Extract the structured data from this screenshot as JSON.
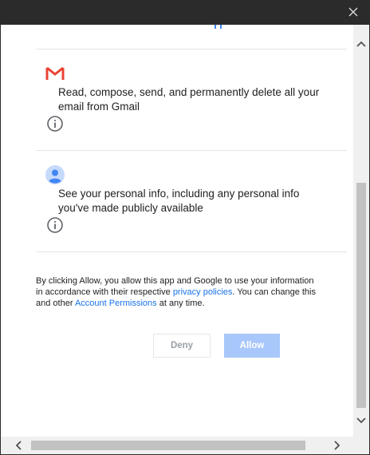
{
  "permissions": [
    {
      "icon": "gmail-icon",
      "text": "Read, compose, send, and permanently delete all your email from Gmail"
    },
    {
      "icon": "account-icon",
      "text": "See your personal info, including any personal info you've made publicly available"
    }
  ],
  "disclaimer": {
    "part1": "By clicking Allow, you allow this app and Google to use your information in accordance with their respective ",
    "privacy_link": "privacy policies",
    "part2": ". You can change this and other ",
    "account_link": "Account Permissions",
    "part3": " at any time."
  },
  "buttons": {
    "deny_label": "Deny",
    "allow_label": "Allow"
  },
  "colors": {
    "link": "#1a73e8",
    "allow_disabled": "#a8c7fa",
    "gmail_red": "#ea4335"
  }
}
